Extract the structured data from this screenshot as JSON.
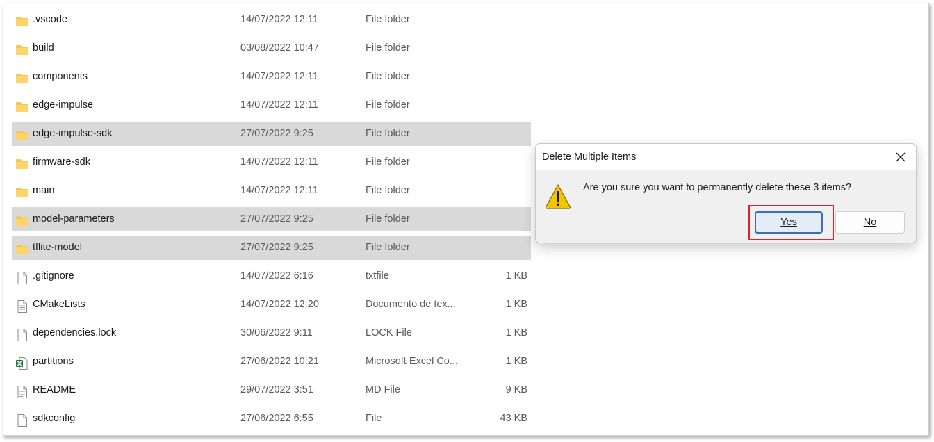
{
  "files": [
    {
      "name": ".vscode",
      "date": "14/07/2022 12:11",
      "type": "File folder",
      "size": "",
      "icon": "folder-icon",
      "selected": false
    },
    {
      "name": "build",
      "date": "03/08/2022 10:47",
      "type": "File folder",
      "size": "",
      "icon": "folder-icon",
      "selected": false
    },
    {
      "name": "components",
      "date": "14/07/2022 12:11",
      "type": "File folder",
      "size": "",
      "icon": "folder-icon",
      "selected": false
    },
    {
      "name": "edge-impulse",
      "date": "14/07/2022 12:11",
      "type": "File folder",
      "size": "",
      "icon": "folder-icon",
      "selected": false
    },
    {
      "name": "edge-impulse-sdk",
      "date": "27/07/2022 9:25",
      "type": "File folder",
      "size": "",
      "icon": "folder-icon",
      "selected": true
    },
    {
      "name": "firmware-sdk",
      "date": "14/07/2022 12:11",
      "type": "File folder",
      "size": "",
      "icon": "folder-icon",
      "selected": false
    },
    {
      "name": "main",
      "date": "14/07/2022 12:11",
      "type": "File folder",
      "size": "",
      "icon": "folder-icon",
      "selected": false
    },
    {
      "name": "model-parameters",
      "date": "27/07/2022 9:25",
      "type": "File folder",
      "size": "",
      "icon": "folder-icon",
      "selected": true
    },
    {
      "name": "tflite-model",
      "date": "27/07/2022 9:25",
      "type": "File folder",
      "size": "",
      "icon": "folder-icon",
      "selected": true
    },
    {
      "name": ".gitignore",
      "date": "14/07/2022 6:16",
      "type": "txtfile",
      "size": "1 KB",
      "icon": "blank-file-icon",
      "selected": false
    },
    {
      "name": "CMakeLists",
      "date": "14/07/2022 12:20",
      "type": "Documento de tex...",
      "size": "1 KB",
      "icon": "text-file-icon",
      "selected": false
    },
    {
      "name": "dependencies.lock",
      "date": "30/06/2022 9:11",
      "type": "LOCK File",
      "size": "1 KB",
      "icon": "blank-file-icon",
      "selected": false
    },
    {
      "name": "partitions",
      "date": "27/06/2022 10:21",
      "type": "Microsoft Excel Co...",
      "size": "1 KB",
      "icon": "excel-file-icon",
      "selected": false
    },
    {
      "name": "README",
      "date": "29/07/2022 3:51",
      "type": "MD File",
      "size": "9 KB",
      "icon": "text-file-icon",
      "selected": false
    },
    {
      "name": "sdkconfig",
      "date": "27/06/2022 6:55",
      "type": "File",
      "size": "43 KB",
      "icon": "blank-file-icon",
      "selected": false
    }
  ],
  "dialog": {
    "title": "Delete Multiple Items",
    "message": "Are you sure you want to permanently delete these 3 items?",
    "yes_label": "Yes",
    "no_label": "No",
    "icon": "warning-icon",
    "close_icon": "close-icon"
  },
  "colors": {
    "selection": "#d9d9d9",
    "folder": "#f8c74f",
    "highlight": "#e0202a",
    "default_button_border": "#3a6fb0"
  }
}
